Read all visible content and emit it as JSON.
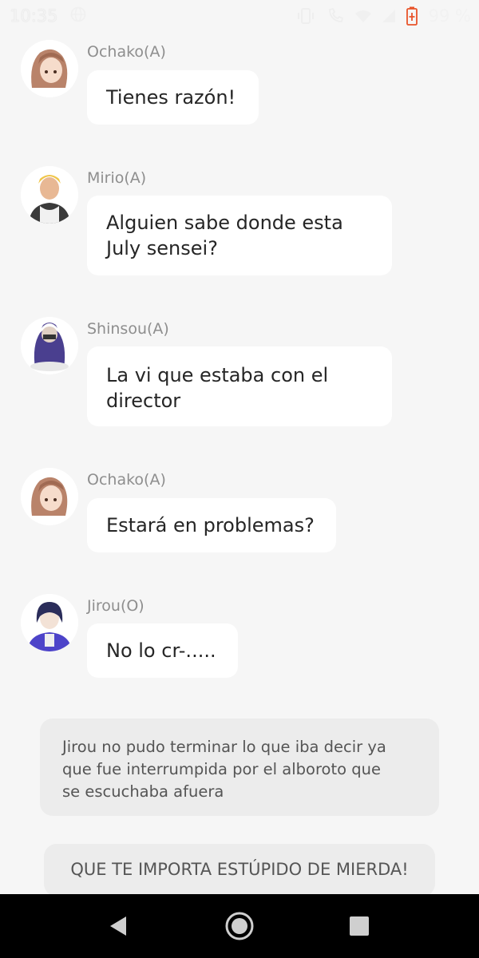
{
  "status_bar": {
    "time": "10:35",
    "battery": "99 %",
    "icons": [
      "globe-icon",
      "vibrate-icon",
      "call-icon",
      "wifi-icon",
      "signal-icon",
      "battery-icon"
    ]
  },
  "messages": [
    {
      "name": "Ochako(A)",
      "lines": [
        "Tienes razón!"
      ],
      "avatar": "ochako-avatar"
    },
    {
      "name": "Mirio(A)",
      "lines": [
        "Alguien sabe donde esta",
        "July sensei?"
      ],
      "avatar": "mirio-avatar"
    },
    {
      "name": "Shinsou(A)",
      "lines": [
        "La vi que estaba con el",
        "director"
      ],
      "avatar": "shinsou-avatar"
    },
    {
      "name": "Ochako(A)",
      "lines": [
        "Estará en problemas?"
      ],
      "avatar": "ochako-avatar"
    },
    {
      "name": "Jirou(O)",
      "lines": [
        "No lo cr-....."
      ],
      "avatar": "jirou-avatar"
    }
  ],
  "narration": {
    "lines": [
      "Jirou no pudo terminar lo que iba decir ya",
      "que fue interrumpida por el alboroto que",
      "se escuchaba afuera"
    ]
  },
  "narration2": {
    "text": "QUE TE IMPORTA ESTÚPIDO DE MIERDA!"
  },
  "nav": {
    "buttons": [
      "back-icon",
      "home-icon",
      "recents-icon"
    ]
  },
  "colors": {
    "background": "#f6f6f6",
    "bubble": "#ffffff",
    "narration": "#ececec",
    "name_text": "#8e8e8e",
    "battery_accent": "#e8542a"
  }
}
